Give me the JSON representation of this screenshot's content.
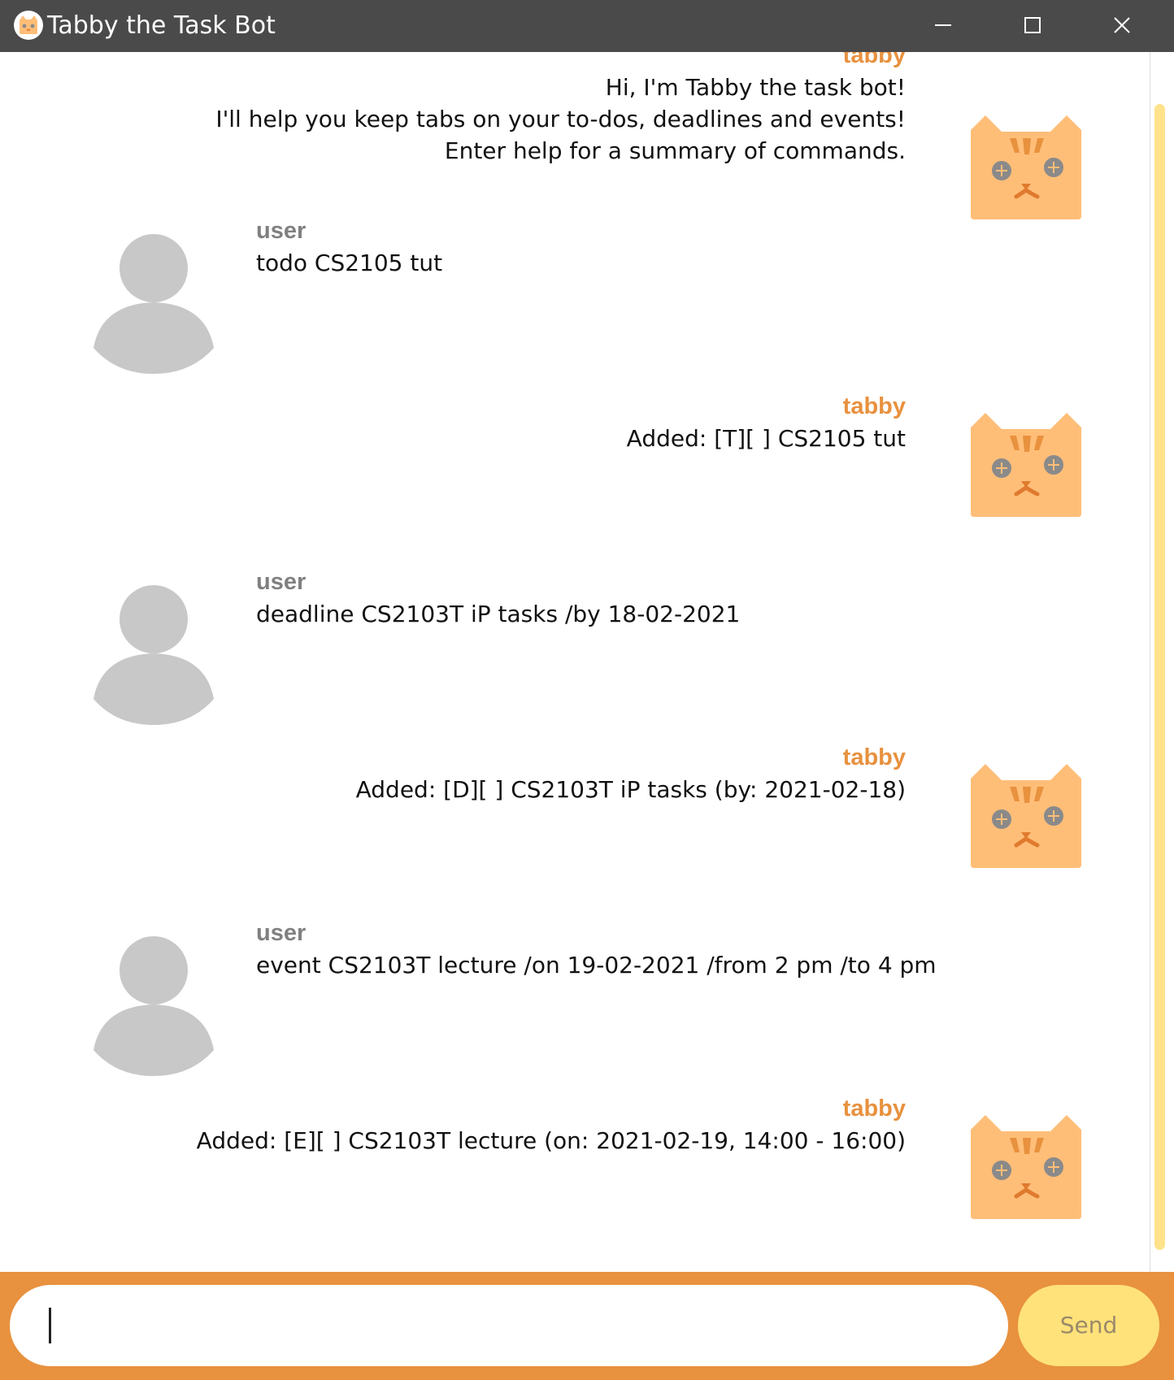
{
  "window": {
    "title": "Tabby the Task Bot"
  },
  "colors": {
    "titlebar": "#4a4a4a",
    "accent": "#e8913e",
    "send_button": "#ffe27a",
    "cat_face": "#ffbe78",
    "avatar": "#c8c8c8"
  },
  "messages": [
    {
      "sender": "tabby",
      "lines": [
        "Hi, I'm Tabby the task bot!",
        "I'll help you keep tabs on your to-dos, deadlines and events!",
        "Enter help for a summary of commands."
      ]
    },
    {
      "sender": "user",
      "lines": [
        "todo CS2105 tut"
      ]
    },
    {
      "sender": "tabby",
      "lines": [
        "Added: [T][ ] CS2105 tut"
      ]
    },
    {
      "sender": "user",
      "lines": [
        "deadline CS2103T iP tasks /by 18-02-2021"
      ]
    },
    {
      "sender": "tabby",
      "lines": [
        "Added: [D][ ] CS2103T iP tasks (by: 2021-02-18)"
      ]
    },
    {
      "sender": "user",
      "lines": [
        "event CS2103T lecture /on 19-02-2021 /from 2 pm /to 4 pm"
      ]
    },
    {
      "sender": "tabby",
      "lines": [
        "Added: [E][ ] CS2103T lecture (on: 2021-02-19, 14:00 - 16:00)"
      ]
    }
  ],
  "input": {
    "value": "",
    "placeholder": ""
  },
  "send_label": "Send",
  "icons": {
    "app": "cat-face-icon",
    "bot_avatar": "cat-face-icon",
    "user_avatar": "person-silhouette-icon"
  }
}
